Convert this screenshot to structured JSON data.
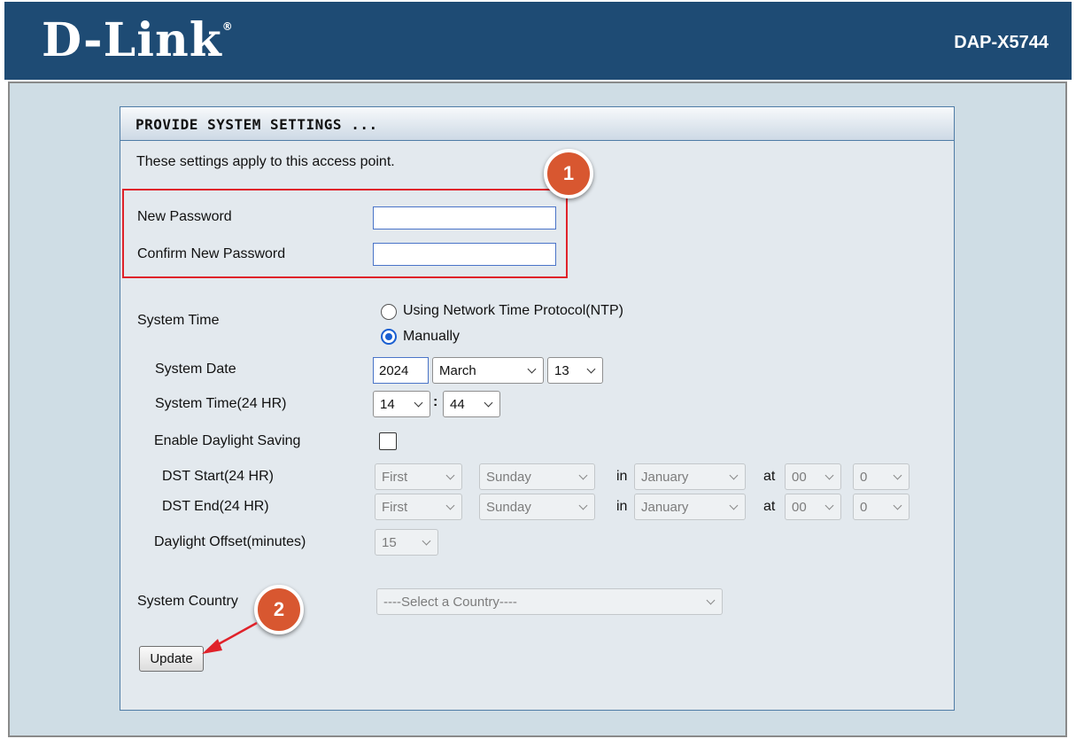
{
  "header": {
    "brand": "D-Link",
    "registered_mark": "®",
    "model": "DAP-X5744"
  },
  "panel": {
    "title": "PROVIDE SYSTEM SETTINGS ...",
    "description": "These settings apply to this access point."
  },
  "password": {
    "new_label": "New Password",
    "new_value": "",
    "confirm_label": "Confirm New Password",
    "confirm_value": ""
  },
  "system_time": {
    "label": "System Time",
    "ntp_option": "Using Network Time Protocol(NTP)",
    "manual_option": "Manually",
    "selected": "Manually"
  },
  "system_date": {
    "label": "System Date",
    "year": "2024",
    "month": "March",
    "day": "13"
  },
  "system_clock": {
    "label": "System Time(24 HR)",
    "hour": "14",
    "separator": ":",
    "minute": "44"
  },
  "daylight": {
    "enable_label": "Enable Daylight Saving",
    "enabled": false,
    "start_label": "DST Start(24 HR)",
    "end_label": "DST End(24 HR)",
    "in_label": "in",
    "at_label": "at",
    "start": {
      "week": "First",
      "weekday": "Sunday",
      "month": "January",
      "hour": "00",
      "minute": "0"
    },
    "end": {
      "week": "First",
      "weekday": "Sunday",
      "month": "January",
      "hour": "00",
      "minute": "0"
    },
    "offset_label": "Daylight Offset(minutes)",
    "offset_value": "15"
  },
  "country": {
    "label": "System Country",
    "selected": "----Select a Country----"
  },
  "update_button": "Update",
  "annotations": {
    "step1": "1",
    "step2": "2",
    "badge_color": "#d85730",
    "highlight_color": "#e0222a"
  }
}
